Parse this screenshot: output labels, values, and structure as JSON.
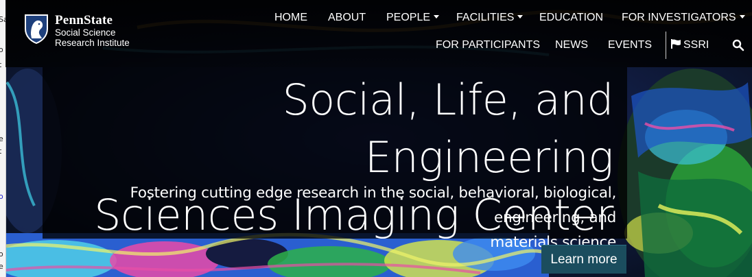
{
  "logo": {
    "brand": "PennState",
    "line1": "Social Science",
    "line2": "Research Institute"
  },
  "nav": {
    "home": "HOME",
    "about": "ABOUT",
    "people": "PEOPLE",
    "facilities": "FACILITIES",
    "education": "EDUCATION",
    "for_investigators": "FOR INVESTIGATORS",
    "for_participants": "FOR PARTICIPANTS",
    "news": "NEWS",
    "events": "EVENTS",
    "ssri": "SSRI"
  },
  "hero": {
    "title_line1": "Social, Life, and Engineering",
    "title_line2": "Sciences Imaging Center",
    "subtitle_line1": "Fostering cutting edge research in the social, behavioral, biological, engineering, and",
    "subtitle_line2": "materials science",
    "button": "Learn more"
  },
  "left_strip": [
    "Sa",
    "o",
    "t",
    "e",
    "t",
    "o",
    "o",
    "e"
  ],
  "icons": {
    "logo": "penn-state-nittany-lion-shield-icon",
    "dropdown": "caret-down-icon",
    "flag": "flag-icon",
    "search": "search-icon"
  }
}
